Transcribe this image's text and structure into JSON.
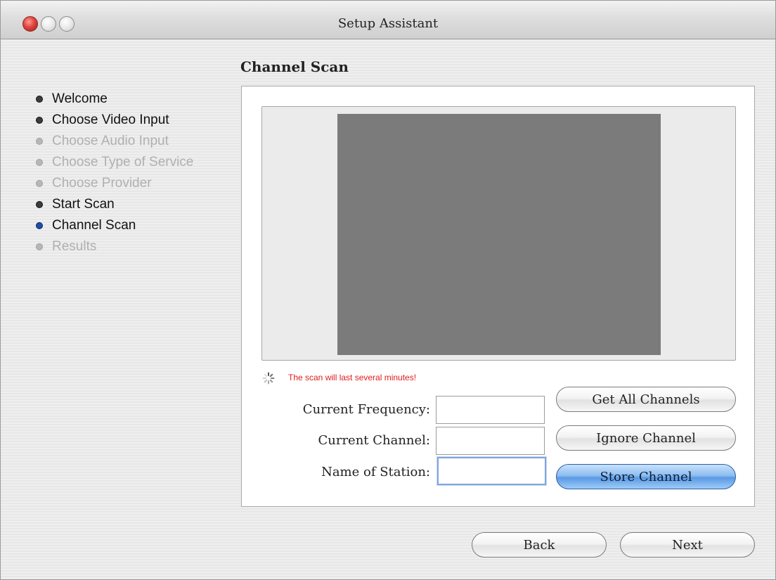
{
  "window": {
    "title": "Setup Assistant"
  },
  "sidebar": {
    "steps": [
      {
        "label": "Welcome",
        "state": "done"
      },
      {
        "label": "Choose Video Input",
        "state": "done"
      },
      {
        "label": "Choose Audio Input",
        "state": "todo"
      },
      {
        "label": "Choose Type of Service",
        "state": "todo"
      },
      {
        "label": "Choose Provider",
        "state": "todo"
      },
      {
        "label": "Start Scan",
        "state": "done"
      },
      {
        "label": "Channel Scan",
        "state": "current"
      },
      {
        "label": "Results",
        "state": "todo"
      }
    ]
  },
  "panel": {
    "title": "Channel Scan",
    "status_message": "The scan will last several minutes!",
    "fields": {
      "frequency": {
        "label": "Current Frequency:",
        "value": ""
      },
      "channel": {
        "label": "Current Channel:",
        "value": ""
      },
      "station": {
        "label": "Name of Station:",
        "value": ""
      }
    },
    "buttons": {
      "get_all": "Get All Channels",
      "ignore": "Ignore Channel",
      "store": "Store Channel"
    }
  },
  "footer": {
    "back": "Back",
    "next": "Next"
  },
  "colors": {
    "status_text": "#e01b1b",
    "current_step": "#1d4fa6",
    "default_button": "#5b9ae5",
    "video_placeholder": "#7b7b7b"
  },
  "icons": {
    "spinner": "progress-spinner-icon",
    "close": "close-icon",
    "minimize": "minimize-icon",
    "zoom": "zoom-icon"
  }
}
